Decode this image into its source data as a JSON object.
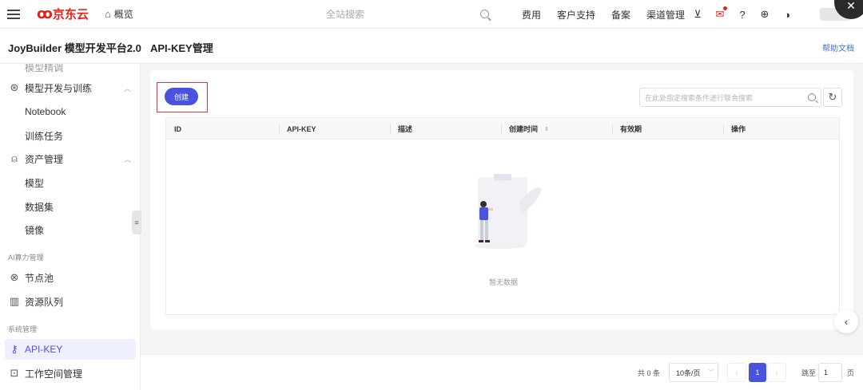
{
  "topbar": {
    "brand": "京东云",
    "home_label": "概览",
    "search_placeholder": "全站搜索",
    "nav": [
      "费用",
      "客户支持",
      "备案",
      "渠道管理"
    ]
  },
  "header": {
    "product_title": "JoyBuilder 模型开发平台2.0",
    "page_title": "API-KEY管理",
    "help_link": "帮助文档"
  },
  "sidebar": {
    "cut_item": "模型精调",
    "model_dev": "模型开发与训练",
    "notebook": "Notebook",
    "training": "训练任务",
    "assets": "资产管理",
    "model": "模型",
    "dataset": "数据集",
    "image": "镜像",
    "group_compute": "AI算力管理",
    "node_pool": "节点池",
    "resource_queue": "资源队列",
    "group_system": "系统管理",
    "api_key": "API-KEY",
    "workspace": "工作空间管理"
  },
  "toolbar": {
    "create_label": "创建",
    "filter_placeholder": "在此处指定搜索条件进行联合搜索"
  },
  "table": {
    "columns": [
      "ID",
      "API-KEY",
      "描述",
      "创建时间",
      "有效期",
      "操作"
    ],
    "sort_glyph": "⇕",
    "empty_text": "暂无数据"
  },
  "pagination": {
    "total": "共 0 条",
    "page_size": "10条/页",
    "current_page": "1",
    "jump_label": "跳至",
    "jump_value": "1",
    "jump_unit": "页"
  },
  "colors": {
    "accent": "#4a52e0",
    "brand_red": "#e2231a",
    "highlight": "#d9363e"
  }
}
